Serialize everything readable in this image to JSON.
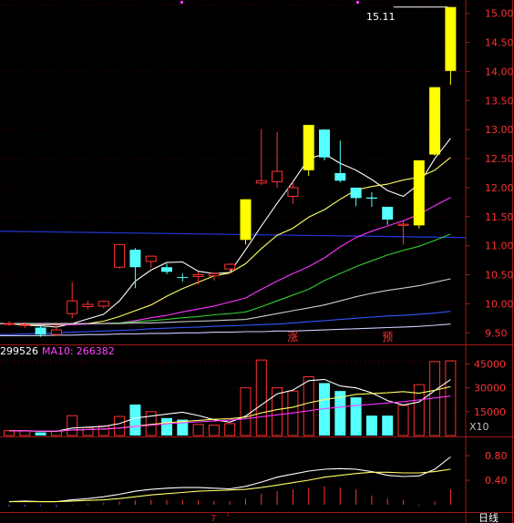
{
  "chart_data": [
    {
      "type": "candlestick",
      "panel": "price",
      "ylim": [
        9.3,
        15.2
      ],
      "y_ticks": [
        "15.00",
        "14.50",
        "14.00",
        "13.50",
        "13.00",
        "12.50",
        "12.00",
        "11.50",
        "11.00",
        "10.50",
        "10.00",
        "9.50"
      ],
      "y_tick_values": [
        15.0,
        14.5,
        14.0,
        13.5,
        13.0,
        12.5,
        12.0,
        11.5,
        11.0,
        10.5,
        10.0,
        9.5
      ],
      "high_label": "15.11",
      "bars": [
        {
          "o": 9.66,
          "h": 9.7,
          "l": 9.62,
          "c": 9.66
        },
        {
          "o": 9.64,
          "h": 9.68,
          "l": 9.58,
          "c": 9.64
        },
        {
          "o": 9.59,
          "h": 9.63,
          "l": 9.43,
          "c": 9.47
        },
        {
          "o": 9.47,
          "h": 9.63,
          "l": 9.46,
          "c": 9.55
        },
        {
          "o": 9.83,
          "h": 10.37,
          "l": 9.75,
          "c": 10.05
        },
        {
          "o": 9.95,
          "h": 10.05,
          "l": 9.9,
          "c": 9.99
        },
        {
          "o": 9.96,
          "h": 10.06,
          "l": 9.92,
          "c": 10.04
        },
        {
          "o": 10.63,
          "h": 11.02,
          "l": 10.6,
          "c": 11.02
        },
        {
          "o": 10.93,
          "h": 10.96,
          "l": 10.27,
          "c": 10.63
        },
        {
          "o": 10.73,
          "h": 10.82,
          "l": 10.62,
          "c": 10.82
        },
        {
          "o": 10.63,
          "h": 10.69,
          "l": 10.51,
          "c": 10.55
        },
        {
          "o": 10.46,
          "h": 10.52,
          "l": 10.38,
          "c": 10.45
        },
        {
          "o": 10.47,
          "h": 10.55,
          "l": 10.33,
          "c": 10.5
        },
        {
          "o": 10.48,
          "h": 10.55,
          "l": 10.4,
          "c": 10.52
        },
        {
          "o": 10.6,
          "h": 10.7,
          "l": 10.53,
          "c": 10.68
        },
        {
          "o": 11.1,
          "h": 11.79,
          "l": 11.02,
          "c": 11.8
        },
        {
          "o": 12.08,
          "h": 13.01,
          "l": 12.04,
          "c": 12.12
        },
        {
          "o": 12.1,
          "h": 12.96,
          "l": 12.0,
          "c": 12.28
        },
        {
          "o": 11.85,
          "h": 12.1,
          "l": 11.72,
          "c": 12.0
        },
        {
          "o": 12.3,
          "h": 13.08,
          "l": 12.2,
          "c": 13.08
        },
        {
          "o": 13.0,
          "h": 13.01,
          "l": 12.47,
          "c": 12.52
        },
        {
          "o": 12.25,
          "h": 12.81,
          "l": 12.09,
          "c": 12.12
        },
        {
          "o": 12.0,
          "h": 12.0,
          "l": 11.68,
          "c": 11.82
        },
        {
          "o": 11.83,
          "h": 11.92,
          "l": 11.67,
          "c": 11.81
        },
        {
          "o": 11.67,
          "h": 11.67,
          "l": 11.36,
          "c": 11.45
        },
        {
          "o": 11.35,
          "h": 11.42,
          "l": 11.02,
          "c": 11.37
        },
        {
          "o": 11.35,
          "h": 12.47,
          "l": 11.3,
          "c": 12.47
        },
        {
          "o": 12.57,
          "h": 13.73,
          "l": 12.55,
          "c": 13.73
        },
        {
          "o": 14.01,
          "h": 15.11,
          "l": 13.77,
          "c": 15.11
        }
      ],
      "ma_lines": [
        {
          "name": "white",
          "color": "#ffffff",
          "values": [
            9.66,
            9.63,
            9.62,
            9.6,
            9.66,
            9.74,
            9.82,
            10.05,
            10.39,
            10.58,
            10.71,
            10.72,
            10.56,
            10.52,
            10.54,
            10.93,
            11.34,
            11.73,
            12.1,
            12.5,
            12.58,
            12.42,
            12.3,
            12.14,
            11.95,
            11.85,
            12.06,
            12.5,
            12.85
          ]
        },
        {
          "name": "yellow",
          "color": "#ffff66",
          "values": [
            9.66,
            9.65,
            9.64,
            9.64,
            9.64,
            9.66,
            9.7,
            9.78,
            9.88,
            9.98,
            10.13,
            10.26,
            10.37,
            10.48,
            10.53,
            10.69,
            10.95,
            11.18,
            11.3,
            11.49,
            11.62,
            11.8,
            11.96,
            12.02,
            12.06,
            12.13,
            12.18,
            12.3,
            12.52
          ]
        },
        {
          "name": "magenta",
          "color": "#ff33ff",
          "values": [
            9.66,
            9.66,
            9.65,
            9.65,
            9.64,
            9.65,
            9.66,
            9.67,
            9.71,
            9.76,
            9.8,
            9.86,
            9.91,
            9.96,
            10.03,
            10.1,
            10.25,
            10.39,
            10.52,
            10.64,
            10.79,
            10.98,
            11.14,
            11.25,
            11.34,
            11.43,
            11.54,
            11.69,
            11.83
          ]
        },
        {
          "name": "green",
          "color": "#33cc33",
          "values": [
            9.66,
            9.66,
            9.66,
            9.66,
            9.66,
            9.66,
            9.66,
            9.67,
            9.69,
            9.71,
            9.73,
            9.76,
            9.78,
            9.81,
            9.83,
            9.86,
            9.95,
            10.05,
            10.15,
            10.25,
            10.4,
            10.52,
            10.64,
            10.74,
            10.84,
            10.92,
            10.99,
            11.09,
            11.2
          ]
        },
        {
          "name": "gray",
          "color": "#cccccc",
          "values": [
            9.66,
            9.66,
            9.66,
            9.66,
            9.66,
            9.66,
            9.66,
            9.66,
            9.67,
            9.67,
            9.68,
            9.69,
            9.7,
            9.71,
            9.72,
            9.73,
            9.78,
            9.83,
            9.88,
            9.93,
            9.98,
            10.05,
            10.12,
            10.18,
            10.23,
            10.27,
            10.31,
            10.37,
            10.43
          ]
        },
        {
          "name": "blue",
          "color": "#3355ff",
          "values": [
            9.47,
            9.48,
            9.49,
            9.5,
            9.51,
            9.52,
            9.53,
            9.54,
            9.55,
            9.57,
            9.58,
            9.59,
            9.6,
            9.61,
            9.62,
            9.63,
            9.64,
            9.65,
            9.67,
            9.69,
            9.71,
            9.73,
            9.75,
            9.77,
            9.79,
            9.8,
            9.82,
            9.84,
            9.87
          ]
        },
        {
          "name": "light",
          "color": "#ccccff",
          "values": [
            9.45,
            9.45,
            9.45,
            9.46,
            9.46,
            9.47,
            9.47,
            9.48,
            9.48,
            9.49,
            9.49,
            9.5,
            9.5,
            9.51,
            9.51,
            9.52,
            9.52,
            9.53,
            9.53,
            9.54,
            9.55,
            9.56,
            9.57,
            9.58,
            9.59,
            9.6,
            9.61,
            9.63,
            9.65
          ]
        }
      ],
      "flat_line": {
        "color": "#2233cc",
        "start": 11.25,
        "end": 11.14
      },
      "markers": [
        {
          "text": "涨",
          "bar": 18
        },
        {
          "text": "预",
          "bar": 24
        }
      ]
    },
    {
      "type": "bar",
      "panel": "volume",
      "label_prefix": "299526",
      "ma10_label": "MA10:",
      "ma10_value": "266382",
      "unit_label": "X10",
      "ylim": [
        0,
        47000
      ],
      "y_ticks": [
        "45000",
        "30000",
        "15000"
      ],
      "y_tick_values": [
        45000,
        30000,
        15000
      ],
      "values": [
        3000,
        3000,
        2000,
        2800,
        12500,
        5000,
        6000,
        12000,
        19500,
        15000,
        11000,
        10000,
        7000,
        6500,
        7500,
        30000,
        47500,
        30000,
        28000,
        37000,
        33000,
        28000,
        24000,
        12500,
        12500,
        19000,
        32000,
        46500,
        47000
      ],
      "ma_lines": [
        {
          "color": "#ffffff",
          "values": [
            3000,
            3000,
            2700,
            2700,
            4700,
            5300,
            5700,
            7500,
            11000,
            12200,
            13500,
            14700,
            12600,
            9900,
            8400,
            12200,
            19300,
            26200,
            28600,
            34500,
            35300,
            31200,
            30000,
            26900,
            22000,
            19200,
            21100,
            28300,
            35200
          ]
        },
        {
          "color": "#ffff66",
          "values": [
            3000,
            3000,
            2700,
            2700,
            3500,
            3800,
            4100,
            4700,
            5900,
            7000,
            8000,
            8800,
            9500,
            10200,
            10600,
            11600,
            14300,
            16300,
            17800,
            20600,
            22600,
            24100,
            25900,
            26400,
            26900,
            27600,
            26600,
            28500,
            30700
          ]
        },
        {
          "color": "#ff33ff",
          "values": [
            3000,
            3000,
            2800,
            2800,
            3500,
            3800,
            4200,
            4700,
            5700,
            6500,
            7400,
            8000,
            8600,
            9100,
            9800,
            10500,
            11800,
            13000,
            14200,
            15600,
            16900,
            17900,
            18900,
            19600,
            20500,
            21300,
            22400,
            23600,
            24800
          ]
        }
      ]
    },
    {
      "type": "bar",
      "panel": "indicator",
      "ylim": [
        -0.12,
        1.1
      ],
      "y_ticks": [
        "0.80",
        "0.40"
      ],
      "y_tick_values": [
        0.8,
        0.4
      ],
      "values": [
        -0.03,
        -0.03,
        -0.02,
        -0.04,
        0.01,
        0.02,
        0.03,
        0.05,
        0.07,
        0.08,
        0.08,
        0.08,
        0.07,
        0.06,
        0.06,
        0.1,
        0.18,
        0.22,
        0.25,
        0.28,
        0.3,
        0.28,
        0.25,
        0.15,
        0.1,
        0.08,
        -0.02,
        0.05,
        0.25
      ],
      "lines": [
        {
          "color": "#ffffff",
          "values": [
            0.05,
            0.06,
            0.05,
            0.05,
            0.08,
            0.1,
            0.13,
            0.17,
            0.22,
            0.25,
            0.27,
            0.28,
            0.28,
            0.27,
            0.26,
            0.3,
            0.37,
            0.45,
            0.5,
            0.55,
            0.58,
            0.59,
            0.58,
            0.54,
            0.48,
            0.46,
            0.47,
            0.58,
            0.78
          ]
        },
        {
          "color": "#ffff66",
          "values": [
            0.05,
            0.05,
            0.05,
            0.05,
            0.06,
            0.07,
            0.08,
            0.1,
            0.13,
            0.16,
            0.18,
            0.2,
            0.22,
            0.23,
            0.24,
            0.25,
            0.28,
            0.32,
            0.36,
            0.4,
            0.45,
            0.48,
            0.51,
            0.53,
            0.53,
            0.52,
            0.52,
            0.54,
            0.58
          ]
        }
      ]
    }
  ],
  "x_axis": {
    "tick_label": "7",
    "tick_bar": 14
  },
  "corner_label": "日线"
}
